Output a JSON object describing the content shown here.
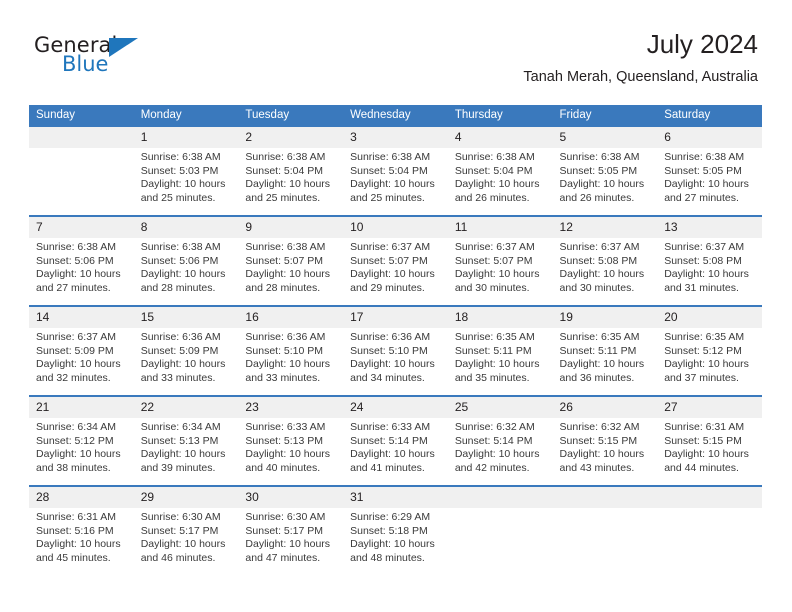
{
  "brand": {
    "name_part1": "General",
    "name_part2": "Blue",
    "logo_icon": "triangle-icon",
    "accent_color": "#1f76bc"
  },
  "header": {
    "title": "July 2024",
    "subtitle": "Tanah Merah, Queensland, Australia"
  },
  "calendar": {
    "header_color": "#3a79bd",
    "daynum_bg": "#f0f0f0",
    "weekday_headers": [
      "Sunday",
      "Monday",
      "Tuesday",
      "Wednesday",
      "Thursday",
      "Friday",
      "Saturday"
    ],
    "weeks": [
      [
        {
          "day": "",
          "sunrise": "",
          "sunset": "",
          "daylight_line1": "",
          "daylight_line2": ""
        },
        {
          "day": "1",
          "sunrise": "Sunrise: 6:38 AM",
          "sunset": "Sunset: 5:03 PM",
          "daylight_line1": "Daylight: 10 hours",
          "daylight_line2": "and 25 minutes."
        },
        {
          "day": "2",
          "sunrise": "Sunrise: 6:38 AM",
          "sunset": "Sunset: 5:04 PM",
          "daylight_line1": "Daylight: 10 hours",
          "daylight_line2": "and 25 minutes."
        },
        {
          "day": "3",
          "sunrise": "Sunrise: 6:38 AM",
          "sunset": "Sunset: 5:04 PM",
          "daylight_line1": "Daylight: 10 hours",
          "daylight_line2": "and 25 minutes."
        },
        {
          "day": "4",
          "sunrise": "Sunrise: 6:38 AM",
          "sunset": "Sunset: 5:04 PM",
          "daylight_line1": "Daylight: 10 hours",
          "daylight_line2": "and 26 minutes."
        },
        {
          "day": "5",
          "sunrise": "Sunrise: 6:38 AM",
          "sunset": "Sunset: 5:05 PM",
          "daylight_line1": "Daylight: 10 hours",
          "daylight_line2": "and 26 minutes."
        },
        {
          "day": "6",
          "sunrise": "Sunrise: 6:38 AM",
          "sunset": "Sunset: 5:05 PM",
          "daylight_line1": "Daylight: 10 hours",
          "daylight_line2": "and 27 minutes."
        }
      ],
      [
        {
          "day": "7",
          "sunrise": "Sunrise: 6:38 AM",
          "sunset": "Sunset: 5:06 PM",
          "daylight_line1": "Daylight: 10 hours",
          "daylight_line2": "and 27 minutes."
        },
        {
          "day": "8",
          "sunrise": "Sunrise: 6:38 AM",
          "sunset": "Sunset: 5:06 PM",
          "daylight_line1": "Daylight: 10 hours",
          "daylight_line2": "and 28 minutes."
        },
        {
          "day": "9",
          "sunrise": "Sunrise: 6:38 AM",
          "sunset": "Sunset: 5:07 PM",
          "daylight_line1": "Daylight: 10 hours",
          "daylight_line2": "and 28 minutes."
        },
        {
          "day": "10",
          "sunrise": "Sunrise: 6:37 AM",
          "sunset": "Sunset: 5:07 PM",
          "daylight_line1": "Daylight: 10 hours",
          "daylight_line2": "and 29 minutes."
        },
        {
          "day": "11",
          "sunrise": "Sunrise: 6:37 AM",
          "sunset": "Sunset: 5:07 PM",
          "daylight_line1": "Daylight: 10 hours",
          "daylight_line2": "and 30 minutes."
        },
        {
          "day": "12",
          "sunrise": "Sunrise: 6:37 AM",
          "sunset": "Sunset: 5:08 PM",
          "daylight_line1": "Daylight: 10 hours",
          "daylight_line2": "and 30 minutes."
        },
        {
          "day": "13",
          "sunrise": "Sunrise: 6:37 AM",
          "sunset": "Sunset: 5:08 PM",
          "daylight_line1": "Daylight: 10 hours",
          "daylight_line2": "and 31 minutes."
        }
      ],
      [
        {
          "day": "14",
          "sunrise": "Sunrise: 6:37 AM",
          "sunset": "Sunset: 5:09 PM",
          "daylight_line1": "Daylight: 10 hours",
          "daylight_line2": "and 32 minutes."
        },
        {
          "day": "15",
          "sunrise": "Sunrise: 6:36 AM",
          "sunset": "Sunset: 5:09 PM",
          "daylight_line1": "Daylight: 10 hours",
          "daylight_line2": "and 33 minutes."
        },
        {
          "day": "16",
          "sunrise": "Sunrise: 6:36 AM",
          "sunset": "Sunset: 5:10 PM",
          "daylight_line1": "Daylight: 10 hours",
          "daylight_line2": "and 33 minutes."
        },
        {
          "day": "17",
          "sunrise": "Sunrise: 6:36 AM",
          "sunset": "Sunset: 5:10 PM",
          "daylight_line1": "Daylight: 10 hours",
          "daylight_line2": "and 34 minutes."
        },
        {
          "day": "18",
          "sunrise": "Sunrise: 6:35 AM",
          "sunset": "Sunset: 5:11 PM",
          "daylight_line1": "Daylight: 10 hours",
          "daylight_line2": "and 35 minutes."
        },
        {
          "day": "19",
          "sunrise": "Sunrise: 6:35 AM",
          "sunset": "Sunset: 5:11 PM",
          "daylight_line1": "Daylight: 10 hours",
          "daylight_line2": "and 36 minutes."
        },
        {
          "day": "20",
          "sunrise": "Sunrise: 6:35 AM",
          "sunset": "Sunset: 5:12 PM",
          "daylight_line1": "Daylight: 10 hours",
          "daylight_line2": "and 37 minutes."
        }
      ],
      [
        {
          "day": "21",
          "sunrise": "Sunrise: 6:34 AM",
          "sunset": "Sunset: 5:12 PM",
          "daylight_line1": "Daylight: 10 hours",
          "daylight_line2": "and 38 minutes."
        },
        {
          "day": "22",
          "sunrise": "Sunrise: 6:34 AM",
          "sunset": "Sunset: 5:13 PM",
          "daylight_line1": "Daylight: 10 hours",
          "daylight_line2": "and 39 minutes."
        },
        {
          "day": "23",
          "sunrise": "Sunrise: 6:33 AM",
          "sunset": "Sunset: 5:13 PM",
          "daylight_line1": "Daylight: 10 hours",
          "daylight_line2": "and 40 minutes."
        },
        {
          "day": "24",
          "sunrise": "Sunrise: 6:33 AM",
          "sunset": "Sunset: 5:14 PM",
          "daylight_line1": "Daylight: 10 hours",
          "daylight_line2": "and 41 minutes."
        },
        {
          "day": "25",
          "sunrise": "Sunrise: 6:32 AM",
          "sunset": "Sunset: 5:14 PM",
          "daylight_line1": "Daylight: 10 hours",
          "daylight_line2": "and 42 minutes."
        },
        {
          "day": "26",
          "sunrise": "Sunrise: 6:32 AM",
          "sunset": "Sunset: 5:15 PM",
          "daylight_line1": "Daylight: 10 hours",
          "daylight_line2": "and 43 minutes."
        },
        {
          "day": "27",
          "sunrise": "Sunrise: 6:31 AM",
          "sunset": "Sunset: 5:15 PM",
          "daylight_line1": "Daylight: 10 hours",
          "daylight_line2": "and 44 minutes."
        }
      ],
      [
        {
          "day": "28",
          "sunrise": "Sunrise: 6:31 AM",
          "sunset": "Sunset: 5:16 PM",
          "daylight_line1": "Daylight: 10 hours",
          "daylight_line2": "and 45 minutes."
        },
        {
          "day": "29",
          "sunrise": "Sunrise: 6:30 AM",
          "sunset": "Sunset: 5:17 PM",
          "daylight_line1": "Daylight: 10 hours",
          "daylight_line2": "and 46 minutes."
        },
        {
          "day": "30",
          "sunrise": "Sunrise: 6:30 AM",
          "sunset": "Sunset: 5:17 PM",
          "daylight_line1": "Daylight: 10 hours",
          "daylight_line2": "and 47 minutes."
        },
        {
          "day": "31",
          "sunrise": "Sunrise: 6:29 AM",
          "sunset": "Sunset: 5:18 PM",
          "daylight_line1": "Daylight: 10 hours",
          "daylight_line2": "and 48 minutes."
        },
        {
          "day": "",
          "sunrise": "",
          "sunset": "",
          "daylight_line1": "",
          "daylight_line2": ""
        },
        {
          "day": "",
          "sunrise": "",
          "sunset": "",
          "daylight_line1": "",
          "daylight_line2": ""
        },
        {
          "day": "",
          "sunrise": "",
          "sunset": "",
          "daylight_line1": "",
          "daylight_line2": ""
        }
      ]
    ]
  }
}
